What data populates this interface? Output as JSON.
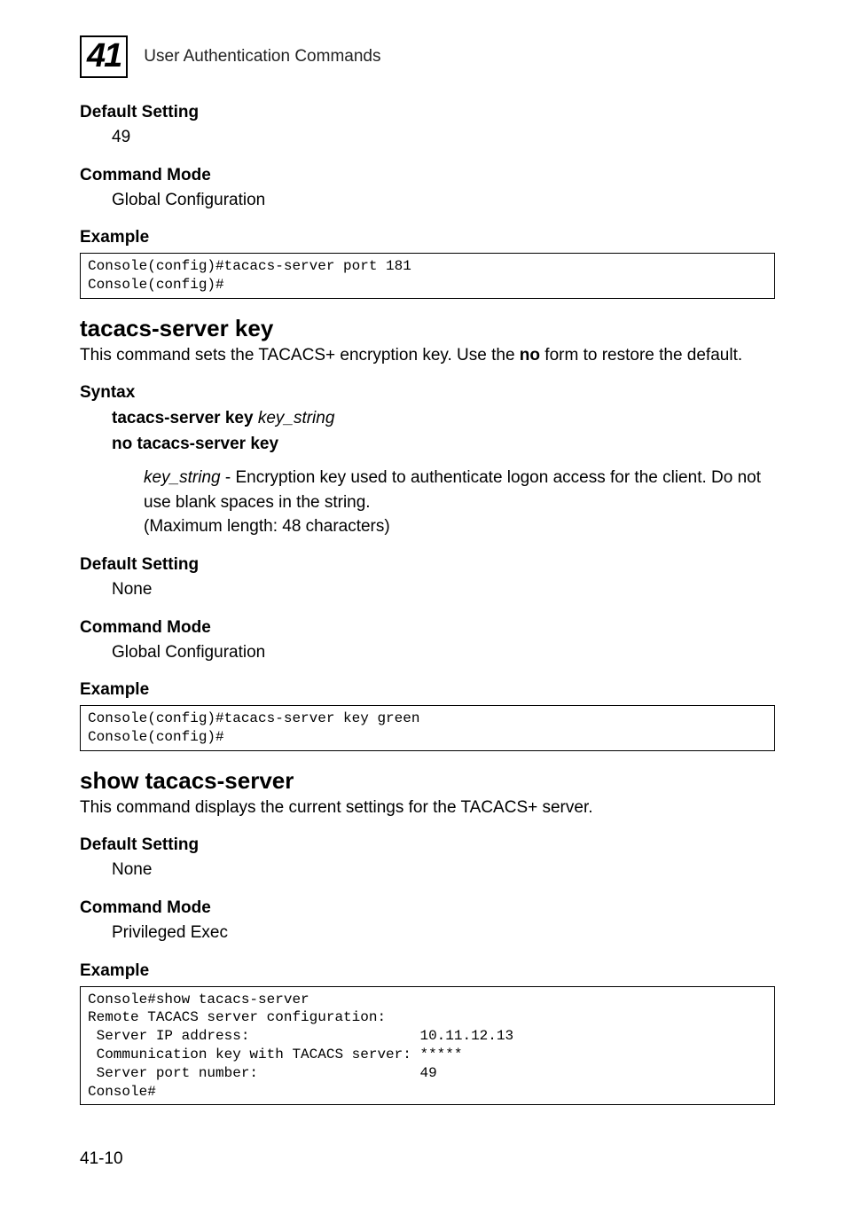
{
  "header": {
    "chapter_number": "41",
    "title": "User Authentication Commands"
  },
  "sec1": {
    "default_setting_h": "Default Setting",
    "default_setting_v": "49",
    "command_mode_h": "Command Mode",
    "command_mode_v": "Global Configuration",
    "example_h": "Example",
    "code": "Console(config)#tacacs-server port 181\nConsole(config)#"
  },
  "sec2": {
    "title": "tacacs-server key",
    "intro_pre": "This command sets the TACACS+ encryption key. Use the ",
    "intro_bold": "no",
    "intro_post": " form to restore the default.",
    "syntax_h": "Syntax",
    "syntax_l1_b": "tacacs-server key ",
    "syntax_l1_i": "key_string",
    "syntax_l2": "no tacacs-server key",
    "desc_i": "key_string",
    "desc_rest": " - Encryption key used to authenticate logon access for the client. Do not use blank spaces in the string.",
    "desc_line3": "(Maximum length: 48 characters)",
    "default_setting_h": "Default Setting",
    "default_setting_v": "None",
    "command_mode_h": "Command Mode",
    "command_mode_v": "Global Configuration",
    "example_h": "Example",
    "code": "Console(config)#tacacs-server key green\nConsole(config)#"
  },
  "sec3": {
    "title": "show tacacs-server",
    "intro": "This command displays the current settings for the TACACS+ server.",
    "default_setting_h": "Default Setting",
    "default_setting_v": "None",
    "command_mode_h": "Command Mode",
    "command_mode_v": "Privileged Exec",
    "example_h": "Example",
    "code": "Console#show tacacs-server\nRemote TACACS server configuration:\n Server IP address:                    10.11.12.13\n Communication key with TACACS server: *****\n Server port number:                   49\nConsole#"
  },
  "footer": {
    "page": "41-10"
  }
}
